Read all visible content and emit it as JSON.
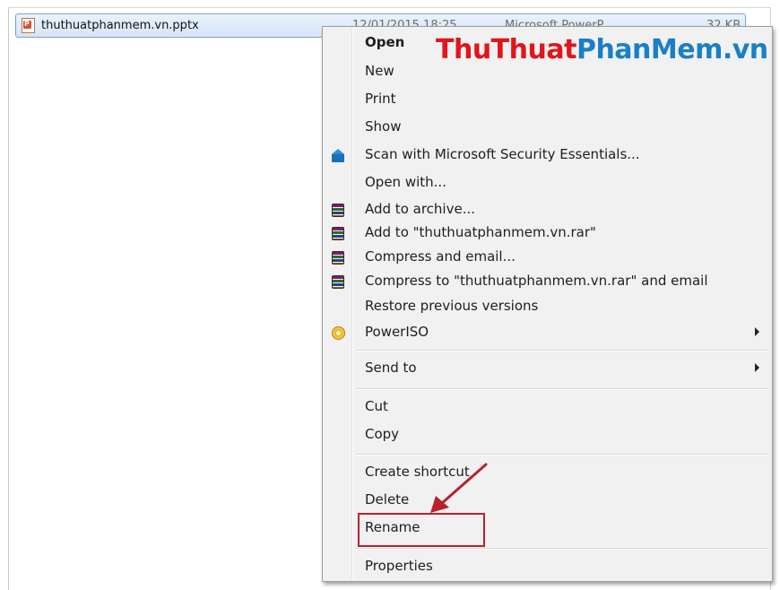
{
  "file": {
    "name": "thuthuatphanmem.vn.pptx",
    "date": "12/01/2015 18:25",
    "type": "Microsoft PowerP...",
    "size": "32 KB",
    "icon": "powerpoint-file-icon"
  },
  "watermark": {
    "part_a": "ThuThuat",
    "part_b": "PhanMem.vn",
    "colors": {
      "part_a": "#e1151c",
      "part_b": "#1a7fc6"
    }
  },
  "context_menu": {
    "open": "Open",
    "new": "New",
    "print": "Print",
    "show": "Show",
    "scan": "Scan with Microsoft Security Essentials...",
    "open_with": "Open with...",
    "add_to_archive": "Add to archive...",
    "add_to_rar": "Add to \"thuthuatphanmem.vn.rar\"",
    "compress_email": "Compress and email...",
    "compress_rar_email": "Compress to \"thuthuatphanmem.vn.rar\" and email",
    "restore_versions": "Restore previous versions",
    "poweriso": "PowerISO",
    "send_to": "Send to",
    "cut": "Cut",
    "copy": "Copy",
    "create_shortcut": "Create shortcut",
    "delete": "Delete",
    "rename": "Rename",
    "properties": "Properties"
  },
  "icons": {
    "scan": "microsoft-security-essentials-icon",
    "winrar": "winrar-icon",
    "poweriso": "poweriso-icon"
  },
  "annotation": {
    "highlight_color": "#b5232b",
    "highlighted_item": "Rename"
  }
}
